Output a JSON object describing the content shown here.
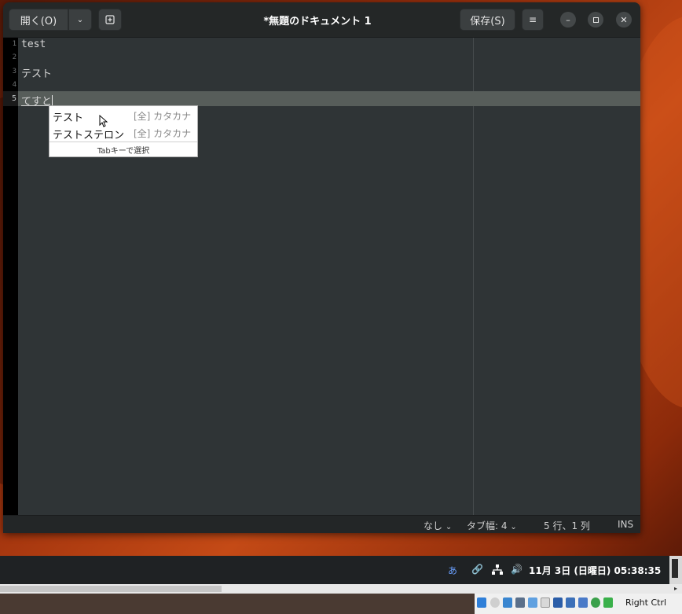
{
  "window": {
    "title": "*無題のドキュメント 1",
    "open_label": "開く(O)",
    "save_label": "保存(S)"
  },
  "editor": {
    "lines": [
      {
        "number": "1",
        "text": "test"
      },
      {
        "number": "2",
        "text": ""
      },
      {
        "number": "3",
        "text": "テスト"
      },
      {
        "number": "4",
        "text": ""
      },
      {
        "number": "5",
        "text": "てすと"
      }
    ],
    "current_line": 5
  },
  "completion": {
    "candidates": [
      {
        "word": "テスト",
        "kind": "[全] カタカナ"
      },
      {
        "word": "テストステロン",
        "kind": "[全] カタカナ"
      }
    ],
    "hint": "Tabキーで選択"
  },
  "statusbar": {
    "syntax": "なし",
    "tab_width": "タブ幅: 4",
    "position": "5 行、1 列",
    "mode": "INS"
  },
  "taskbar": {
    "ime": "あ",
    "clock": "11月  3日 (日曜日) 05:38:35"
  },
  "host": {
    "key_label": "Right Ctrl"
  },
  "colors": {
    "editor_bg": "#2f3436",
    "headerbar_bg": "#242727",
    "current_line": "#575d5a"
  }
}
